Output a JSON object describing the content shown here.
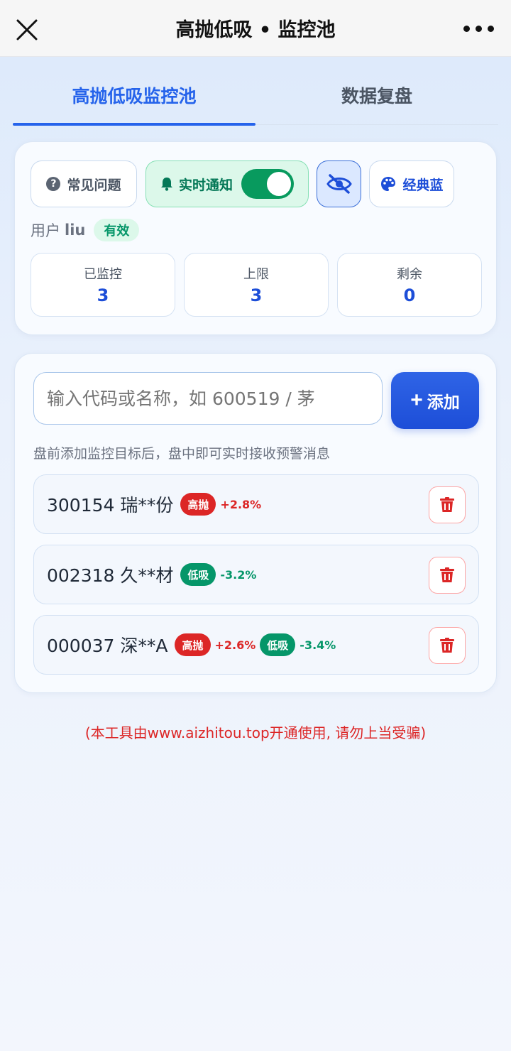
{
  "header": {
    "title": "高抛低吸 • 监控池"
  },
  "tabs": [
    {
      "label": "高抛低吸监控池",
      "active": true
    },
    {
      "label": "数据复盘",
      "active": false
    }
  ],
  "toolbar": {
    "faq_label": "常见问题",
    "notify_label": "实时通知",
    "notify_on": true,
    "theme_label": "经典蓝"
  },
  "user": {
    "label": "用户",
    "name": "liu",
    "status": "有效"
  },
  "stats": [
    {
      "label": "已监控",
      "value": "3"
    },
    {
      "label": "上限",
      "value": "3"
    },
    {
      "label": "剩余",
      "value": "0"
    }
  ],
  "search": {
    "placeholder": "输入代码或名称，如 600519 / 茅",
    "add_label": "添加"
  },
  "hint": "盘前添加监控目标后，盘中即可实时接收预警消息",
  "stocks": [
    {
      "name": "300154 瑞**份",
      "signals": [
        {
          "tag": "高抛",
          "pct": "+2.8%",
          "kind": "high"
        }
      ]
    },
    {
      "name": "002318 久**材",
      "signals": [
        {
          "tag": "低吸",
          "pct": "-3.2%",
          "kind": "low"
        }
      ]
    },
    {
      "name": "000037 深**A",
      "signals": [
        {
          "tag": "高抛",
          "pct": "+2.6%",
          "kind": "high"
        },
        {
          "tag": "低吸",
          "pct": "-3.4%",
          "kind": "low"
        }
      ]
    }
  ],
  "footer": "(本工具由www.aizhitou.top开通使用, 请勿上当受骗)",
  "colors": {
    "accent": "#2563eb",
    "high": "#dc2626",
    "low": "#059669"
  }
}
